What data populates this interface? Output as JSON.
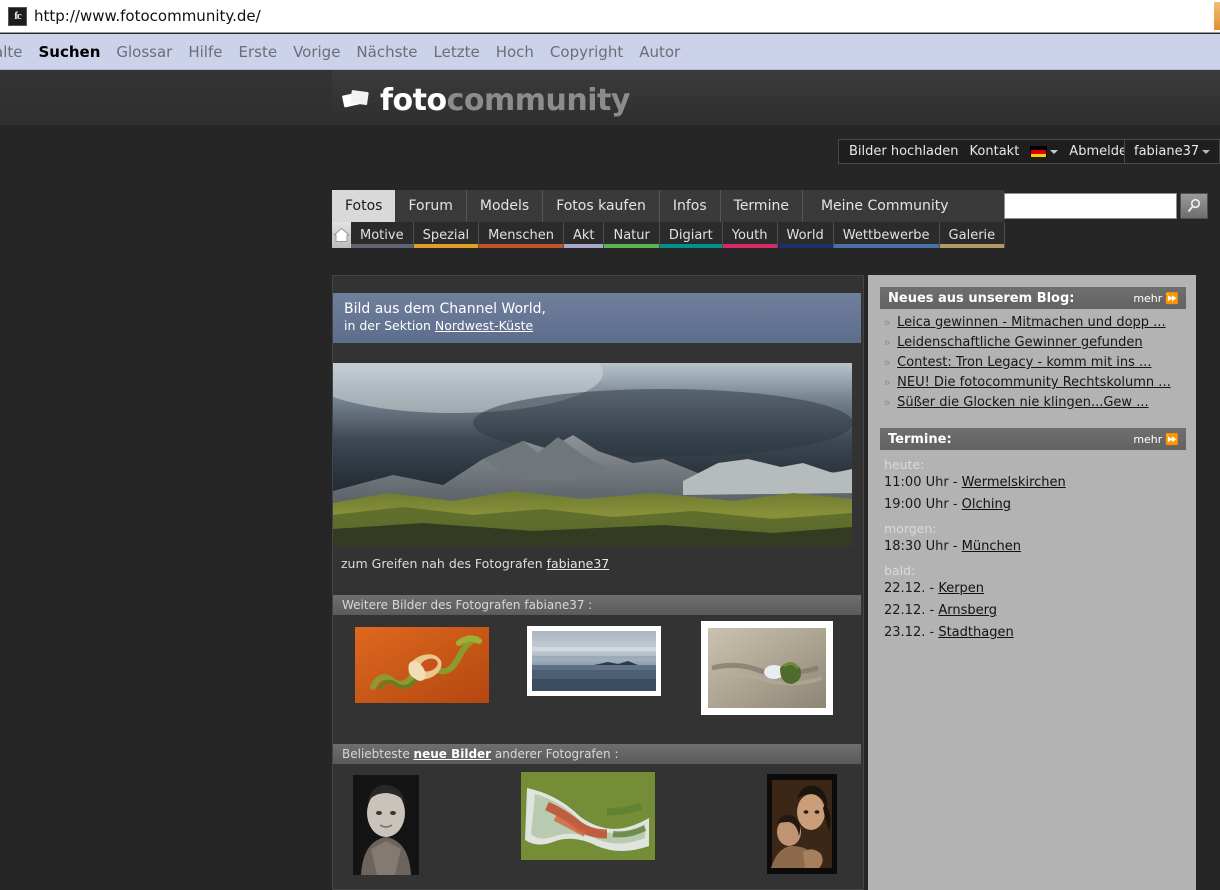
{
  "browser": {
    "favicon_label": "fc",
    "url": "http://www.fotocommunity.de/",
    "linkbar": [
      {
        "label": "alte",
        "active": false,
        "clipped": true
      },
      {
        "label": "Suchen",
        "active": true
      },
      {
        "label": "Glossar",
        "active": false
      },
      {
        "label": "Hilfe",
        "active": false
      },
      {
        "label": "Erste",
        "active": false
      },
      {
        "label": "Vorige",
        "active": false
      },
      {
        "label": "Nächste",
        "active": false
      },
      {
        "label": "Letzte",
        "active": false
      },
      {
        "label": "Hoch",
        "active": false
      },
      {
        "label": "Copyright",
        "active": false
      },
      {
        "label": "Autor",
        "active": false
      }
    ]
  },
  "header": {
    "logo_white": "foto",
    "logo_gray": "community",
    "account": {
      "upload": "Bilder hochladen",
      "contact": "Kontakt",
      "flag": "german-flag",
      "logout": "Abmelden",
      "username": "fabiane37"
    }
  },
  "mainnav": [
    {
      "label": "Fotos",
      "selected": true
    },
    {
      "label": "Forum",
      "selected": false
    },
    {
      "label": "Models",
      "selected": false
    },
    {
      "label": "Fotos kaufen",
      "selected": false
    },
    {
      "label": "Infos",
      "selected": false
    },
    {
      "label": "Termine",
      "selected": false
    },
    {
      "label": "Meine Community",
      "selected": false
    }
  ],
  "search": {
    "value": "",
    "placeholder": "",
    "icon": "magnifier-icon"
  },
  "subnav": {
    "home_icon": "home-icon",
    "items": [
      {
        "label": "Motive",
        "color": "#5f6470"
      },
      {
        "label": "Spezial",
        "color": "#e0a028"
      },
      {
        "label": "Menschen",
        "color": "#c0562a"
      },
      {
        "label": "Akt",
        "color": "#a8a8cc"
      },
      {
        "label": "Natur",
        "color": "#58b552"
      },
      {
        "label": "Digiart",
        "color": "#00938e"
      },
      {
        "label": "Youth",
        "color": "#d62a6a"
      },
      {
        "label": "World",
        "color": "#1d2f6b"
      },
      {
        "label": "Wettbewerbe",
        "color": "#4b6fa8"
      },
      {
        "label": "Galerie",
        "color": "#b09a68"
      }
    ]
  },
  "main": {
    "banner": {
      "line1": "Bild aus dem Channel World,",
      "line2_prefix": "in der Sektion ",
      "line2_link": "Nordwest-Küste"
    },
    "hero_caption": {
      "title": "zum Greifen nah",
      "middle": " des Fotografen ",
      "author": "fabiane37"
    },
    "strip1_title": "Weitere Bilder des Fotografen fabiane37 :",
    "strip2": {
      "prefix": "Beliebteste ",
      "link": "neue Bilder",
      "suffix": " anderer Fotografen :"
    },
    "thumbs_author": [
      {
        "name": "orchid-macro-thumb"
      },
      {
        "name": "coastline-thumb"
      },
      {
        "name": "moss-rock-thumb"
      }
    ],
    "thumbs_popular": [
      {
        "name": "bw-portrait-thumb"
      },
      {
        "name": "lichen-leaf-thumb"
      },
      {
        "name": "mother-child-thumb"
      }
    ]
  },
  "sidebar": {
    "blog": {
      "title": "Neues aus unserem Blog:",
      "more": "mehr",
      "items": [
        "Leica gewinnen - Mitmachen und dopp ...",
        "Leidenschaftliche Gewinner gefunden",
        "Contest: Tron Legacy - komm mit ins ...",
        "NEU! Die fotocommunity Rechtskolumn ...",
        "Süßer die Glocken nie klingen...Gew ..."
      ]
    },
    "termine": {
      "title": "Termine:",
      "more": "mehr",
      "groups": [
        {
          "label": "heute:",
          "events": [
            {
              "time": "11:00 Uhr",
              "dash": " - ",
              "place": "Wermelskirchen"
            },
            {
              "time": "19:00 Uhr",
              "dash": " - ",
              "place": "Olching"
            }
          ]
        },
        {
          "label": "morgen:",
          "events": [
            {
              "time": "18:30 Uhr",
              "dash": " - ",
              "place": "München"
            }
          ]
        },
        {
          "label": "bald:",
          "events": [
            {
              "time": "22.12.",
              "dash": " - ",
              "place": "Kerpen"
            },
            {
              "time": "22.12.",
              "dash": " - ",
              "place": "Arnsberg"
            },
            {
              "time": "23.12.",
              "dash": " - ",
              "place": "Stadthagen"
            }
          ]
        }
      ]
    }
  },
  "colors": {
    "page_bg": "#262626",
    "banner_blue": "#62718f",
    "sidebar_bg": "#b3b3b3",
    "accent_orange": "#e09030"
  }
}
